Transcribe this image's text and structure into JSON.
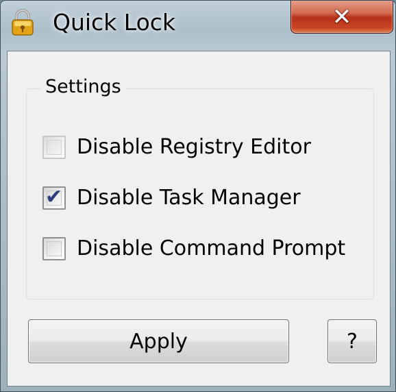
{
  "window": {
    "title": "Quick Lock",
    "close_label": "✕"
  },
  "settings": {
    "group_label": "Settings",
    "options": [
      {
        "label": "Disable Registry Editor",
        "checked": false,
        "enabled": false
      },
      {
        "label": "Disable Task Manager",
        "checked": true,
        "enabled": true
      },
      {
        "label": "Disable Command Prompt",
        "checked": false,
        "enabled": true
      }
    ]
  },
  "buttons": {
    "apply_label": "Apply",
    "help_label": "?"
  },
  "icons": {
    "app": "lock-icon",
    "close": "close-icon",
    "check": "check-icon"
  },
  "colors": {
    "close_button": "#c94425",
    "checkmark": "#2b3d7e"
  }
}
